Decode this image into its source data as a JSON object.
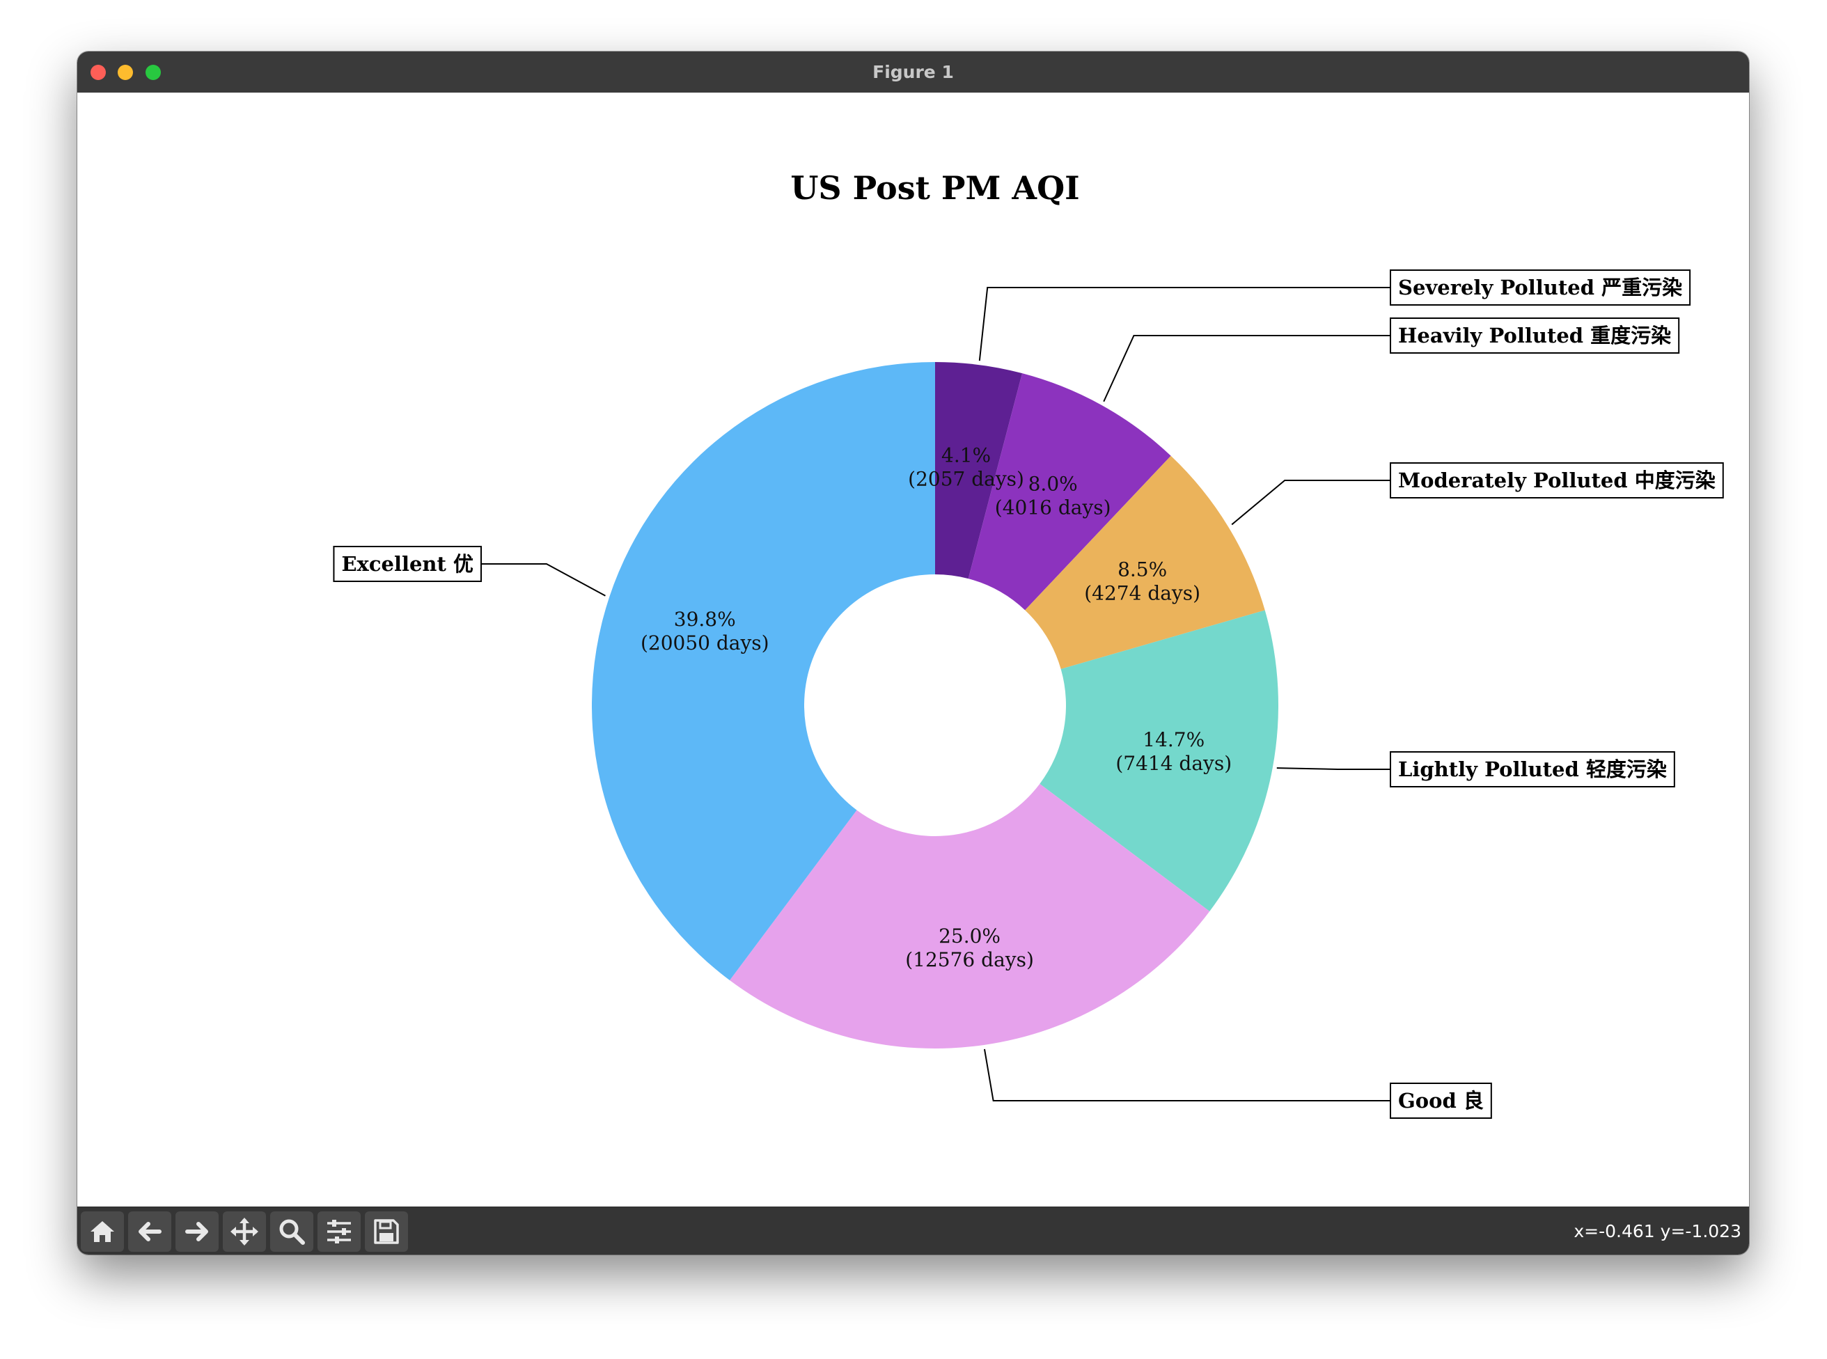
{
  "window": {
    "title": "Figure 1"
  },
  "toolbar": {
    "buttons": [
      {
        "name": "home-icon"
      },
      {
        "name": "back-arrow-icon"
      },
      {
        "name": "forward-arrow-icon"
      },
      {
        "name": "pan-move-icon"
      },
      {
        "name": "zoom-magnifier-icon"
      },
      {
        "name": "configure-subplots-icon"
      },
      {
        "name": "save-disk-icon"
      }
    ],
    "coords": "x=-0.461 y=-1.023"
  },
  "chart_data": {
    "type": "pie",
    "title": "US Post PM AQI",
    "donut": true,
    "start_angle_deg": 90,
    "direction": "clockwise",
    "slices": [
      {
        "label": "Severely Polluted 严重污染",
        "percent": "4.1%",
        "days": "(2057 days)",
        "value": 2057,
        "color": "#5e2093"
      },
      {
        "label": "Heavily Polluted 重度污染",
        "percent": "8.0%",
        "days": "(4016 days)",
        "value": 4016,
        "color": "#8c33be"
      },
      {
        "label": "Moderately Polluted 中度污染",
        "percent": "8.5%",
        "days": "(4274 days)",
        "value": 4274,
        "color": "#ebb35b"
      },
      {
        "label": "Lightly Polluted 轻度污染",
        "percent": "14.7%",
        "days": "(7414 days)",
        "value": 7414,
        "color": "#74d8cc"
      },
      {
        "label": "Good 良",
        "percent": "25.0%",
        "days": "(12576 days)",
        "value": 12576,
        "color": "#e6a2ec"
      },
      {
        "label": "Excellent 优",
        "percent": "39.8%",
        "days": "(20050 days)",
        "value": 20050,
        "color": "#5db8f7"
      }
    ]
  }
}
